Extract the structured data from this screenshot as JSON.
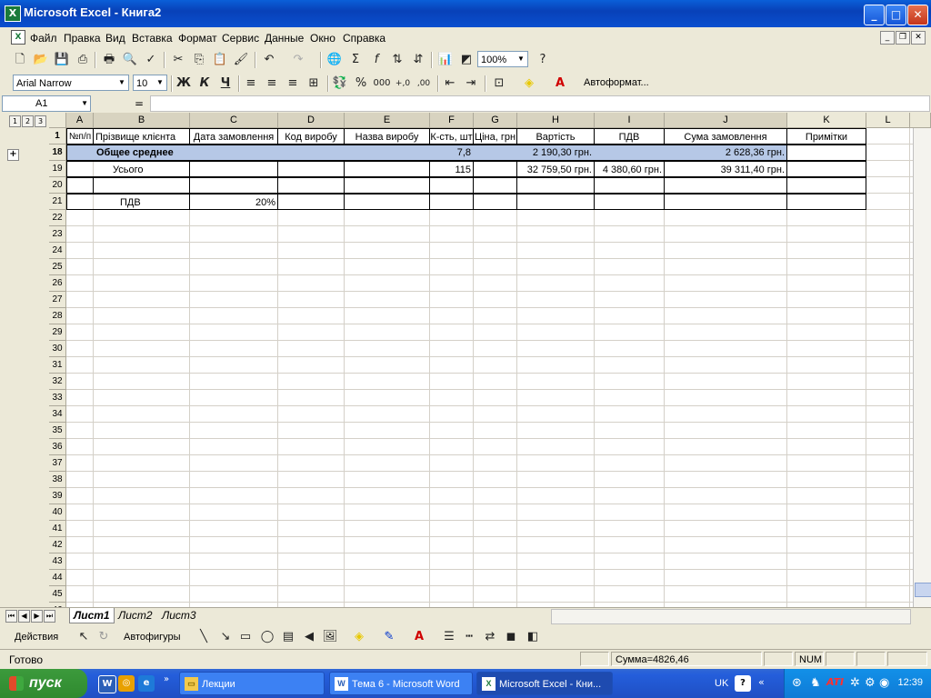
{
  "window": {
    "title": "Microsoft Excel - Книга2",
    "app_icon": "X"
  },
  "menu": {
    "items": [
      "Файл",
      "Правка",
      "Вид",
      "Вставка",
      "Формат",
      "Сервис",
      "Данные",
      "Окно",
      "Справка"
    ],
    "doc_icon": "X"
  },
  "toolbar": {
    "zoom": "100%",
    "font_name": "Arial Narrow",
    "font_size": "10",
    "bold": "Ж",
    "italic": "К",
    "underline": "Ч",
    "autoformat": "Автоформат...",
    "sum_symbol": "Σ",
    "fx_symbol": "f",
    "percent": "%",
    "thousands": "000",
    "inc_decimal": "+,0",
    "dec_decimal": ",00"
  },
  "formula_bar": {
    "name_box": "A1",
    "equals": "="
  },
  "outline_levels": [
    "1",
    "2",
    "3"
  ],
  "columns": [
    "A",
    "B",
    "C",
    "D",
    "E",
    "F",
    "G",
    "H",
    "I",
    "J",
    "K",
    "L"
  ],
  "rows": [
    "1",
    "18",
    "19",
    "20",
    "21",
    "22",
    "23",
    "24",
    "25",
    "26",
    "27",
    "28",
    "29",
    "30",
    "31",
    "32",
    "33",
    "34",
    "35",
    "36",
    "37",
    "38",
    "39",
    "40",
    "41",
    "42",
    "43",
    "44",
    "45",
    "46"
  ],
  "table": {
    "headers": [
      "№п/п",
      "Прізвище клієнта",
      "Дата замовлення",
      "Код виробу",
      "Назва виробу",
      "К-сть, шт",
      "Ціна, грн",
      "Вартість",
      "ПДВ",
      "Сума замовлення",
      "Примітки"
    ],
    "row18": {
      "label": "Общее среднее",
      "qty": "7,8",
      "cost": "2 190,30 грн.",
      "total": "2 628,36 грн."
    },
    "row19": {
      "label": "Усього",
      "qty": "115",
      "cost": "32 759,50 грн.",
      "vat": "4 380,60 грн.",
      "total": "39 311,40 грн."
    },
    "row21": {
      "label": "ПДВ",
      "rate": "20%"
    }
  },
  "sheet_tabs": [
    "Лист1",
    "Лист2",
    "Лист3"
  ],
  "drawing": {
    "actions": "Действия",
    "autoshapes": "Автофигуры"
  },
  "status": {
    "ready": "Готово",
    "sum": "Сумма=4826,46",
    "num": "NUM"
  },
  "taskbar": {
    "start": "пуск",
    "buttons": [
      "Лекции",
      "Тема 6 - Microsoft Word",
      "Microsoft Excel - Кни..."
    ],
    "lang": "UK",
    "clock": "12:39"
  }
}
